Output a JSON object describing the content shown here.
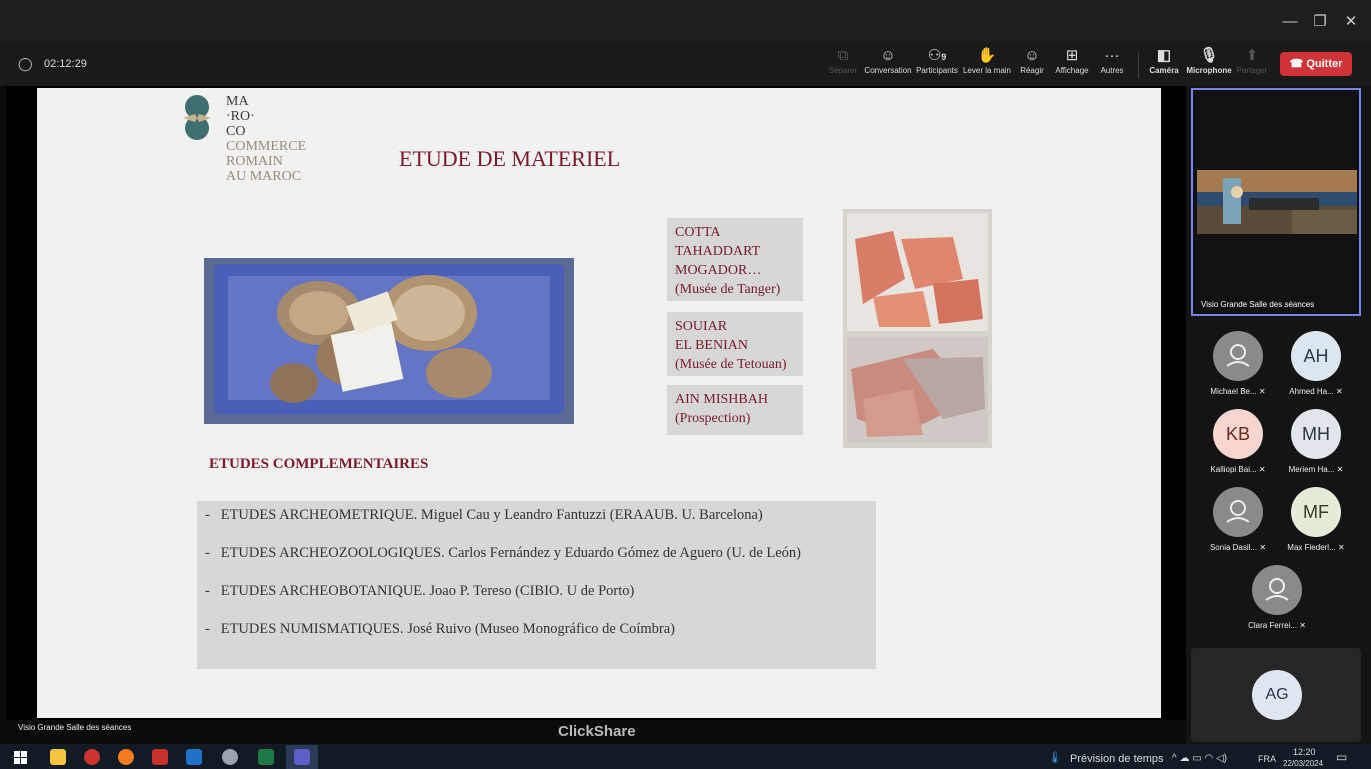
{
  "window": {
    "minimize_glyph": "—",
    "maximize_glyph": "❐",
    "close_glyph": "✕"
  },
  "meeting": {
    "timer": "02:12:29",
    "shield_glyph": "◯"
  },
  "toolbar": {
    "separate": "Séparer",
    "conversation": "Conversation",
    "participants": "Participants",
    "participants_count": "9",
    "raise_hand": "Lever la main",
    "react": "Réagir",
    "view": "Affichage",
    "more": "Autres",
    "camera": "Caméra",
    "microphone": "Microphone",
    "share": "Partager",
    "quit": "Quitter"
  },
  "slide": {
    "logo_lines": [
      "MA",
      "·RO·",
      "CO"
    ],
    "logo_sub": [
      "COMMERCE",
      "ROMAIN",
      "AU MAROC"
    ],
    "title": "ETUDE DE MATERIEL",
    "box1": [
      "COTTA",
      "TAHADDART",
      "MOGADOR…",
      "(Musée de Tanger)"
    ],
    "box2": [
      "SOUIAR",
      "EL BENIAN",
      "(Musée de Tetouan)"
    ],
    "box3": [
      "AIN MISHBAH",
      "(Prospection)"
    ],
    "complementary_heading": "ETUDES COMPLEMENTAIRES",
    "bullet_dash": "-",
    "items": [
      "ETUDES ARCHEOMETRIQUE. Miguel Cau y Leandro Fantuzzi (ERAAUB. U. Barcelona)",
      "ETUDES ARCHEOZOOLOGIQUES. Carlos Fernández y  Eduardo Gómez de Aguero (U. de León)",
      "ETUDES ARCHEOBOTANIQUE. Joao P. Tereso (CIBIO. U de Porto)",
      "ETUDES NUMISMATIQUES. José Ruivo (Museo Monográfico de Coímbra)"
    ]
  },
  "stage": {
    "source_label": "Visio Grande Salle des séances",
    "clickshare": "ClickShare"
  },
  "panel": {
    "video_label": "Visio Grande Salle des séances",
    "participants": [
      {
        "initials": "",
        "name": "Michael Be..."
      },
      {
        "initials": "AH",
        "name": "Ahmed Ha..."
      },
      {
        "initials": "KB",
        "name": "Kalliopi Bai..."
      },
      {
        "initials": "MH",
        "name": "Meriem Ha..."
      },
      {
        "initials": "",
        "name": "Sonia Dasil..."
      },
      {
        "initials": "MF",
        "name": "Max Fiederl..."
      },
      {
        "initials": "",
        "name": "Clara Ferrei..."
      }
    ],
    "self_initials": "AG",
    "mute_glyph": "✕"
  },
  "taskbar": {
    "weather": "Prévision de temps",
    "lang": "FRA",
    "time": "12:20",
    "date": "22/03/2024",
    "tray_glyphs": "^ ☁ ▭ ◠ ◁)"
  },
  "colors": {
    "bordeaux": "#7a1a28",
    "logo_teal": "#3f6f70",
    "quit_red": "#d13438",
    "panel_selected": "#7b83eb"
  }
}
